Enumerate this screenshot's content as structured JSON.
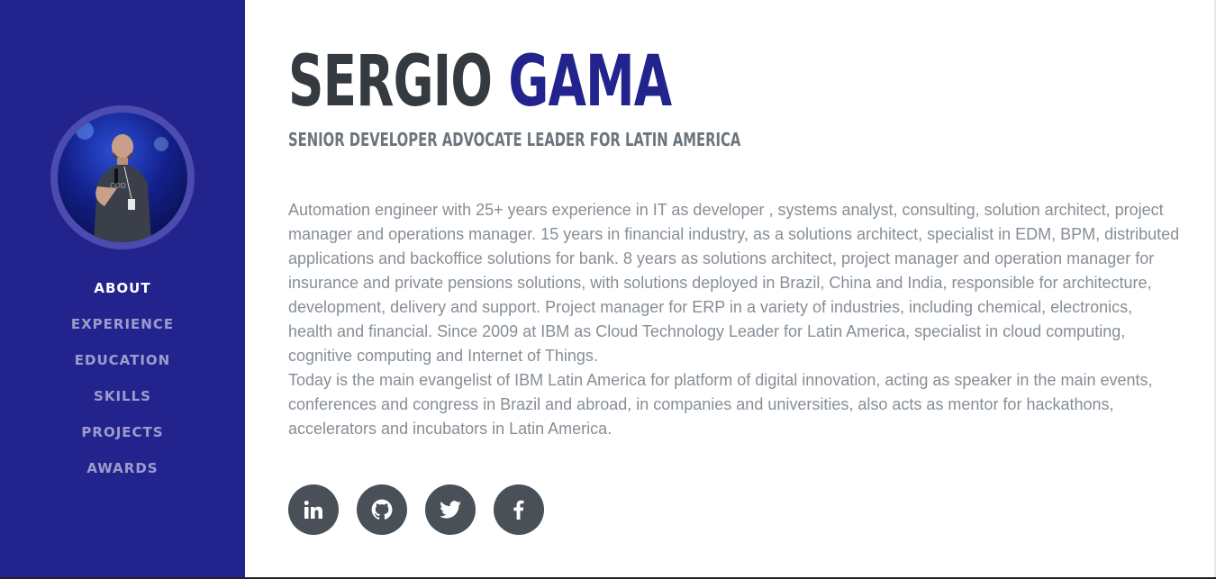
{
  "profile": {
    "first_name": "SERGIO",
    "last_name": "GAMA",
    "subtitle": "SENIOR DEVELOPER ADVOCATE LEADER FOR LATIN AMERICA"
  },
  "nav": {
    "items": [
      {
        "label": "ABOUT",
        "active": true
      },
      {
        "label": "EXPERIENCE"
      },
      {
        "label": "EDUCATION"
      },
      {
        "label": "SKILLS"
      },
      {
        "label": "PROJECTS"
      },
      {
        "label": "AWARDS"
      }
    ]
  },
  "bio": {
    "paragraph1": "Automation engineer with 25+ years experience in IT as developer , systems analyst, consulting, solution architect, project manager and operations manager. 15 years in financial industry, as a solutions architect, specialist in EDM, BPM, distributed applications and backoffice solutions for bank. 8 years as solutions architect, project manager and operation manager for insurance and private pensions solutions, with solutions deployed in Brazil, China and India, responsible for architecture, development, delivery and support. Project manager for ERP in a variety of industries, including chemical, electronics, health and financial. Since 2009 at IBM as Cloud Technology Leader for Latin America, specialist in cloud computing, cognitive computing and Internet of Things.",
    "paragraph2": "Today is the main evangelist of IBM Latin America for platform of digital innovation, acting as speaker in the main events, conferences and congress in Brazil and abroad, in companies and universities, also acts as mentor for hackathons, accelerators and incubators in Latin America."
  },
  "social": [
    {
      "icon": "linkedin-icon"
    },
    {
      "icon": "github-icon"
    },
    {
      "icon": "twitter-icon"
    },
    {
      "icon": "facebook-icon"
    }
  ],
  "colors": {
    "sidebar": "#23238e",
    "accent": "#23238e",
    "heading": "#343a40",
    "text": "#868e96",
    "social_bg": "#495057"
  }
}
